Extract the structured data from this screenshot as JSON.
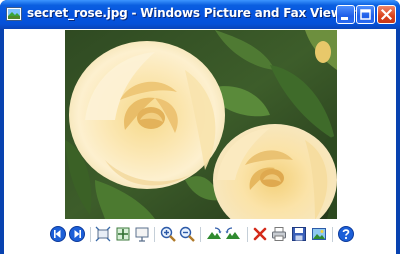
{
  "window": {
    "title": "secret_rose.jpg - Windows Picture and Fax Viewer",
    "icon": "picture-viewer-icon",
    "controls": [
      "minimize-icon",
      "maximize-icon",
      "close-icon"
    ]
  },
  "image": {
    "subject": "two pale yellow roses with green leaves"
  },
  "toolbar": {
    "buttons": [
      "previous-image-icon",
      "next-image-icon",
      "best-fit-icon",
      "actual-size-icon",
      "slideshow-icon",
      "zoom-in-icon",
      "zoom-out-icon",
      "rotate-clockwise-icon",
      "rotate-counterclockwise-icon",
      "delete-icon",
      "print-icon",
      "save-icon",
      "open-for-editing-icon",
      "help-icon"
    ]
  },
  "colors": {
    "titlebar": "#0553e0",
    "frame": "#0842b0",
    "close_button": "#d9421c",
    "nav_button": "#1c5fd8"
  }
}
